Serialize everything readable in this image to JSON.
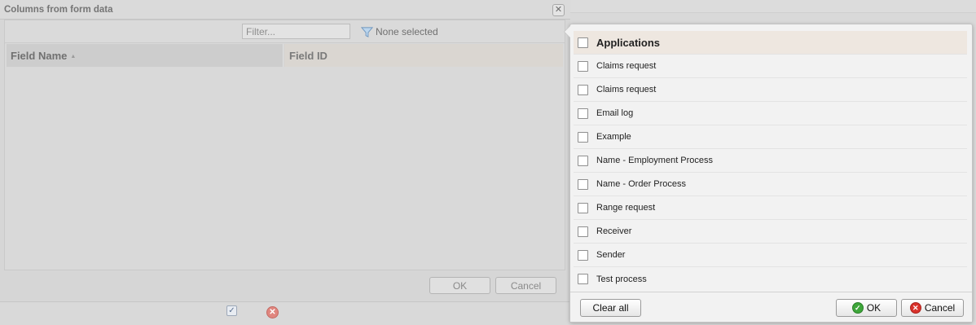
{
  "dialog": {
    "title": "Columns from form data",
    "close_icon": "close-icon",
    "filter": {
      "placeholder": "Filter...",
      "value": ""
    },
    "filter_toggle": {
      "icon": "funnel-icon",
      "label": "None selected"
    },
    "grid": {
      "columns": [
        {
          "label": "Field Name",
          "sorted": "ascending"
        },
        {
          "label": "Field ID"
        }
      ],
      "rows": []
    },
    "buttons": {
      "ok": "OK",
      "cancel": "Cancel"
    },
    "footer": {
      "confirm_icon": "checkbox-icon",
      "cancel_icon": "cancel-icon"
    }
  },
  "popup": {
    "header_label": "Applications",
    "items": [
      "Claims request",
      "Claims request",
      "Email log",
      "Example",
      "Name - Employment Process",
      "Name - Order Process",
      "Range request",
      "Receiver",
      "Sender",
      "Test process"
    ],
    "buttons": {
      "clear_all": "Clear all",
      "ok": "OK",
      "cancel": "Cancel"
    }
  },
  "colors": {
    "popup_header_bg": "#eee7e0",
    "ok_icon": "#3ea63a",
    "cancel_icon": "#d9322b",
    "dimmed_bg": "#d9d9d9"
  }
}
